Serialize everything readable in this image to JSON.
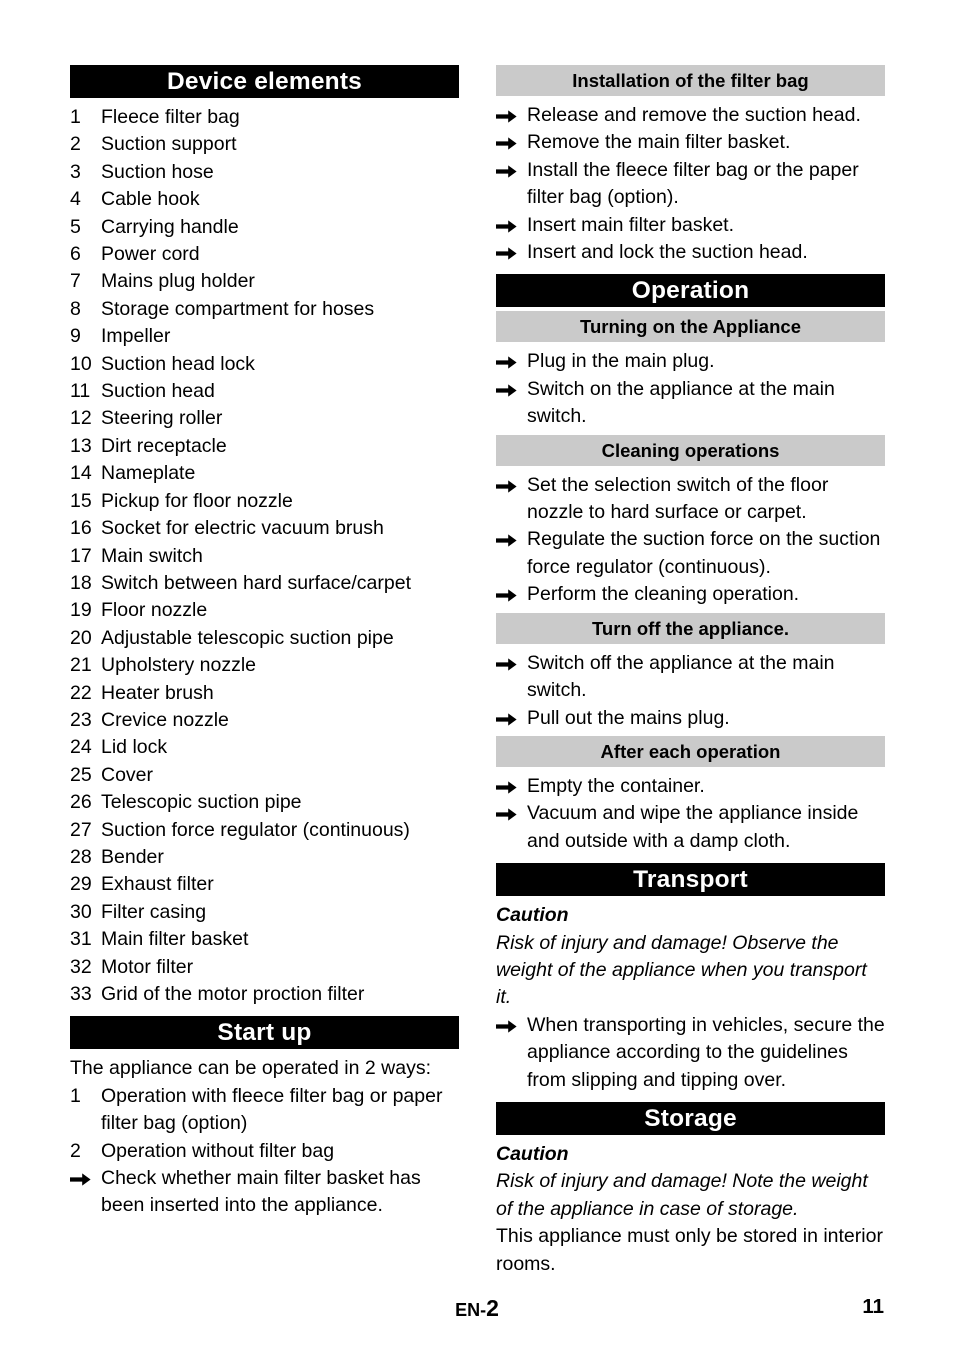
{
  "document": {
    "language_code": "EN",
    "section_number": "2",
    "page_number": "11",
    "separator": "-"
  },
  "colors": {
    "heading_main_bg": "#000000",
    "heading_main_fg": "#ffffff",
    "heading_sub_bg": "#cacaca",
    "heading_sub_fg": "#000000",
    "body_text": "#000000",
    "page_bg": "#ffffff"
  },
  "icons": {
    "arrow_bullet": "arrow-right-bullet"
  },
  "left_column": {
    "device_elements": {
      "heading": "Device elements",
      "items": [
        {
          "num": "1",
          "label": "Fleece filter bag"
        },
        {
          "num": "2",
          "label": "Suction support"
        },
        {
          "num": "3",
          "label": "Suction hose"
        },
        {
          "num": "4",
          "label": "Cable hook"
        },
        {
          "num": "5",
          "label": "Carrying handle"
        },
        {
          "num": "6",
          "label": "Power cord"
        },
        {
          "num": "7",
          "label": "Mains plug holder"
        },
        {
          "num": "8",
          "label": "Storage compartment for hoses"
        },
        {
          "num": "9",
          "label": "Impeller"
        },
        {
          "num": "10",
          "label": "Suction head lock"
        },
        {
          "num": "11",
          "label": "Suction head"
        },
        {
          "num": "12",
          "label": "Steering roller"
        },
        {
          "num": "13",
          "label": "Dirt receptacle"
        },
        {
          "num": "14",
          "label": "Nameplate"
        },
        {
          "num": "15",
          "label": "Pickup for floor nozzle"
        },
        {
          "num": "16",
          "label": "Socket for electric vacuum brush"
        },
        {
          "num": "17",
          "label": "Main switch"
        },
        {
          "num": "18",
          "label": "Switch between hard surface/carpet"
        },
        {
          "num": "19",
          "label": "Floor nozzle"
        },
        {
          "num": "20",
          "label": "Adjustable telescopic suction pipe"
        },
        {
          "num": "21",
          "label": "Upholstery nozzle"
        },
        {
          "num": "22",
          "label": "Heater brush"
        },
        {
          "num": "23",
          "label": "Crevice nozzle"
        },
        {
          "num": "24",
          "label": "Lid lock"
        },
        {
          "num": "25",
          "label": "Cover"
        },
        {
          "num": "26",
          "label": "Telescopic suction pipe"
        },
        {
          "num": "27",
          "label": "Suction force regulator (continuous)"
        },
        {
          "num": "28",
          "label": "Bender"
        },
        {
          "num": "29",
          "label": "Exhaust filter"
        },
        {
          "num": "30",
          "label": "Filter casing"
        },
        {
          "num": "31",
          "label": "Main filter basket"
        },
        {
          "num": "32",
          "label": "Motor filter"
        },
        {
          "num": "33",
          "label": "Grid of the motor proction filter"
        }
      ]
    },
    "start_up": {
      "heading": "Start up",
      "intro": "The appliance can be operated in 2 ways:",
      "items": [
        {
          "num": "1",
          "label": "Operation with fleece filter bag or paper filter bag (option)"
        },
        {
          "num": "2",
          "label": "Operation without filter bag"
        }
      ],
      "steps": [
        "Check whether main filter basket has been inserted into the appliance."
      ]
    }
  },
  "right_column": {
    "installation_filter_bag": {
      "heading": "Installation of the filter bag",
      "heading_style": "sub",
      "steps": [
        "Release and remove the suction head.",
        "Remove the main filter basket.",
        "Install the fleece filter bag or the paper filter bag (option).",
        "Insert main filter basket.",
        "Insert and lock the suction head."
      ]
    },
    "operation": {
      "heading": "Operation",
      "heading_style": "main",
      "subsections": [
        {
          "heading": "Turning on the Appliance",
          "steps": [
            "Plug in the main plug.",
            "Switch on the appliance at the main switch."
          ]
        },
        {
          "heading": "Cleaning operations",
          "steps": [
            "Set the selection switch of the floor nozzle to hard surface or carpet.",
            "Regulate the suction force on the suction force regulator (continuous).",
            "Perform the cleaning operation."
          ]
        },
        {
          "heading": "Turn off the appliance.",
          "steps": [
            "Switch off the appliance at the main switch.",
            "Pull out the mains plug."
          ]
        },
        {
          "heading": "After each operation",
          "steps": [
            "Empty the container.",
            "Vacuum and wipe the appliance inside and outside with a damp cloth."
          ]
        }
      ]
    },
    "transport": {
      "heading": "Transport",
      "heading_style": "main",
      "caution_label": "Caution",
      "caution_text": "Risk of injury and damage! Observe the weight of the appliance when you transport it.",
      "steps": [
        "When transporting in vehicles, secure the appliance according to the guidelines from slipping and tipping over."
      ]
    },
    "storage": {
      "heading": "Storage",
      "heading_style": "main",
      "caution_label": "Caution",
      "caution_text": "Risk of injury and damage! Note the weight of the appliance in case of storage.",
      "body_text": "This appliance must only be stored in interior rooms."
    }
  }
}
